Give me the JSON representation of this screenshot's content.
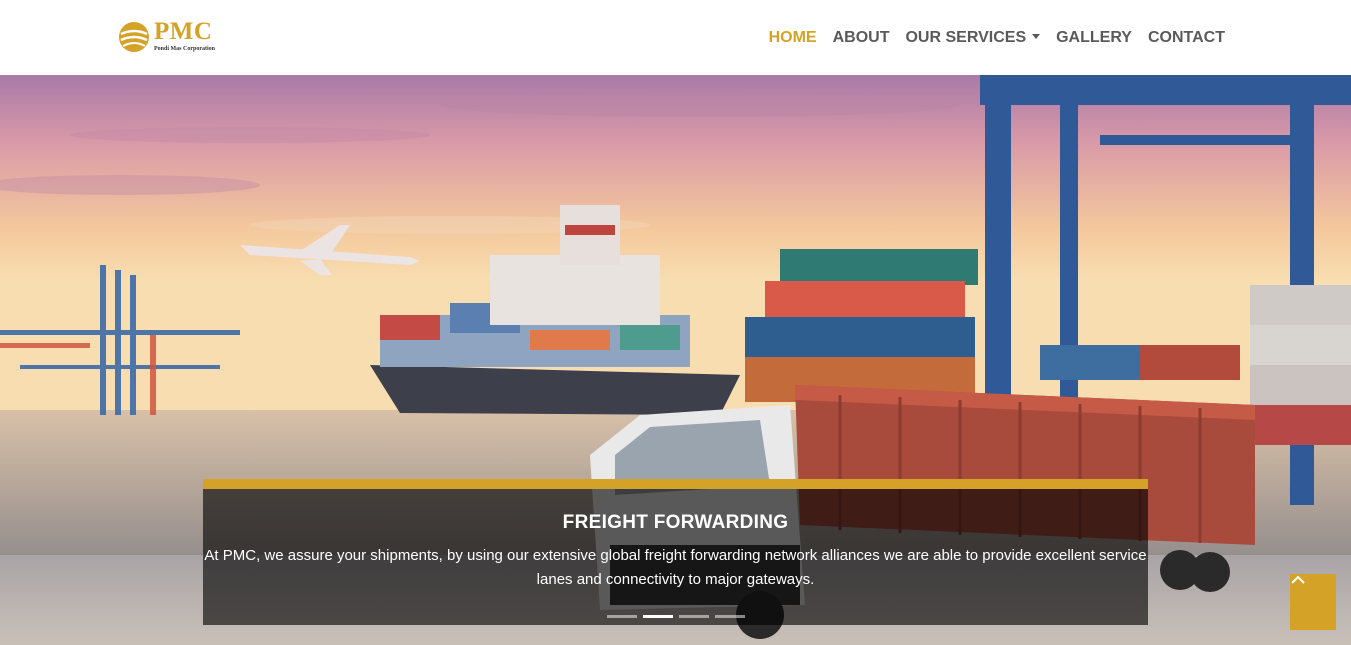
{
  "brand": {
    "name": "PMC",
    "tagline": "Pondi Mas Corporation",
    "accent": "#d4a227"
  },
  "nav": {
    "items": [
      {
        "label": "HOME",
        "active": true
      },
      {
        "label": "ABOUT"
      },
      {
        "label": "OUR SERVICES",
        "dropdown": true
      },
      {
        "label": "GALLERY"
      },
      {
        "label": "CONTACT"
      }
    ]
  },
  "hero": {
    "slide_title": "FREIGHT FORWARDING",
    "slide_text": "At PMC, we assure your shipments, by using our extensive global freight forwarding network alliances we are able to provide excellent service lanes and connectivity to major gateways.",
    "slide_count": 4,
    "active_slide": 2
  },
  "icons": {
    "back_to_top": "chevron-up-icon"
  }
}
